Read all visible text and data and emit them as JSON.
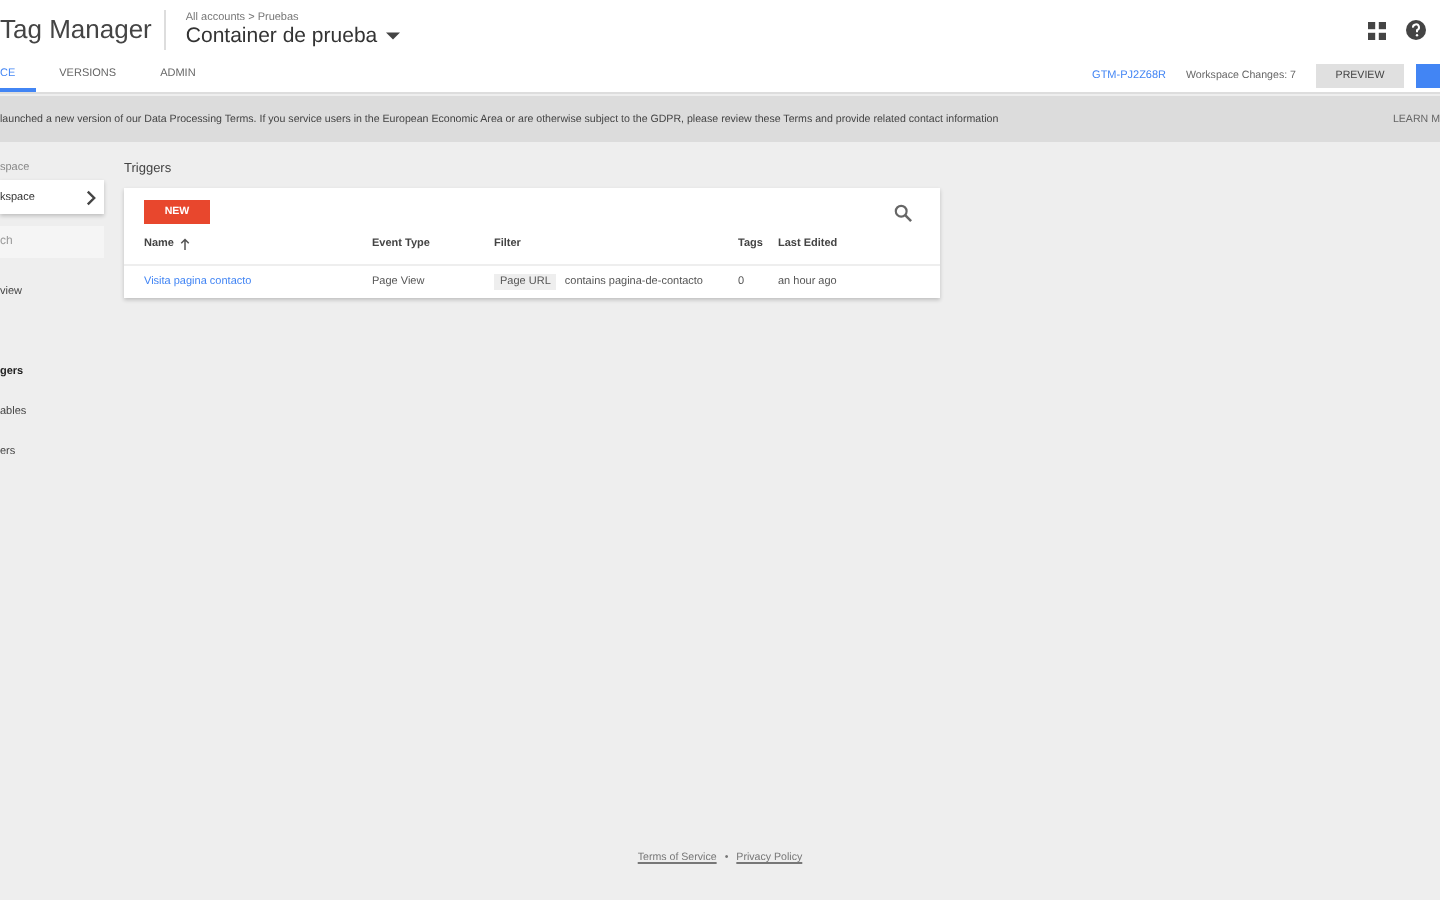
{
  "header": {
    "product": "Tag Manager",
    "breadcrumb": "All accounts > Pruebas",
    "container": "Container de prueba"
  },
  "tabs": [
    {
      "label": "CE",
      "selected": true
    },
    {
      "label": "VERSIONS",
      "selected": false
    },
    {
      "label": "ADMIN",
      "selected": false
    }
  ],
  "toolbar": {
    "container_id": "GTM-PJ2Z68R",
    "changes": "Workspace Changes: 7",
    "preview": "PREVIEW"
  },
  "banner": {
    "text": "launched a new version of our Data Processing Terms. If you service users in the European Economic Area or are otherwise subject to the GDPR, please review these Terms and provide related contact information",
    "link": "LEARN M"
  },
  "sidebar": {
    "section_label": "space",
    "workspace": "kspace",
    "search": {
      "placeholder": "ch"
    },
    "items": [
      {
        "label": "view",
        "selected": false
      },
      {
        "label": "gers",
        "selected": true
      },
      {
        "label": "ables",
        "selected": false
      },
      {
        "label": "ers",
        "selected": false
      }
    ]
  },
  "page_title": "Triggers",
  "table": {
    "new_button": "NEW",
    "columns": [
      "Name",
      "Event Type",
      "Filter",
      "Tags",
      "Last Edited"
    ],
    "rows": [
      {
        "name": "Visita pagina contacto",
        "event_type": "Page View",
        "filter_variable": "Page URL",
        "filter_condition": "contains pagina-de-contacto",
        "tags": "0",
        "last_edited": "an hour ago"
      }
    ]
  },
  "footer": {
    "terms": "Terms of Service",
    "separator": "•",
    "privacy": "Privacy Policy"
  }
}
